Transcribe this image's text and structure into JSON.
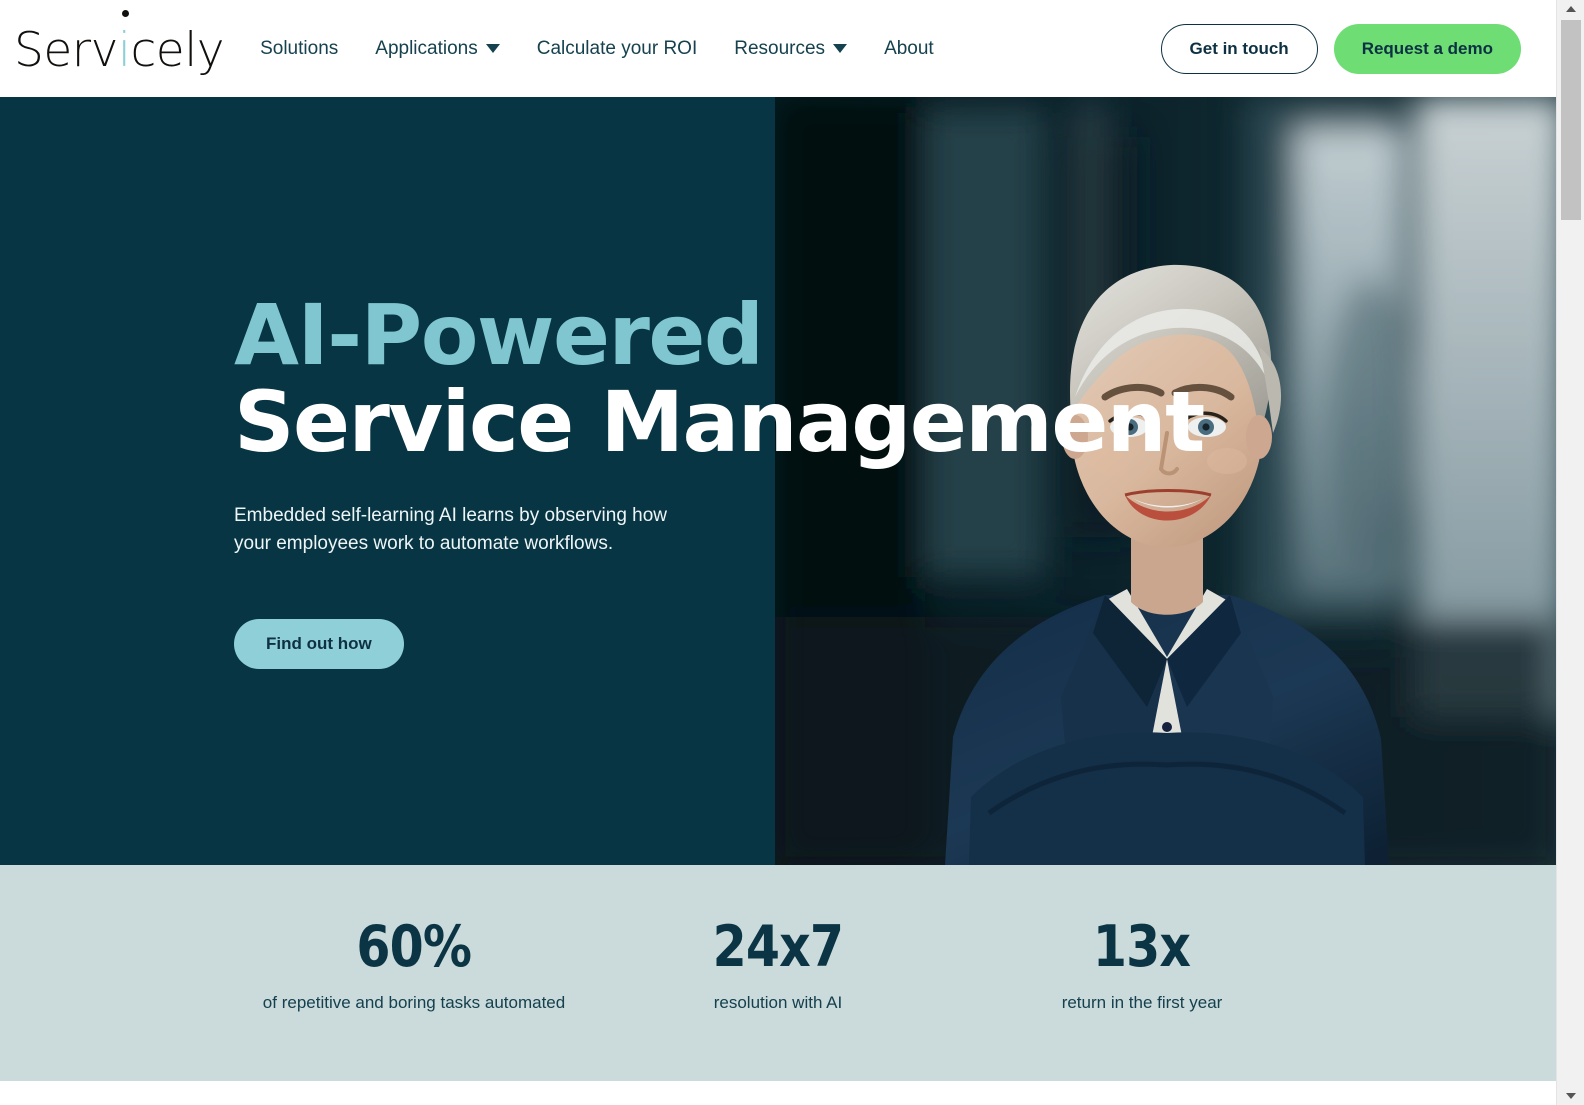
{
  "colors": {
    "hero_bg": "#073543",
    "hero_accent": "#7fc6d0",
    "stats_bg": "#cbdadb",
    "stats_text": "#0b3544",
    "green_cta": "#6ddd74",
    "teal_cta": "#8fd0d8",
    "nav_text": "#16414f"
  },
  "header": {
    "logo": {
      "pre": "Serv",
      "accent": "i",
      "post": "cely",
      "full": "Servicely"
    },
    "nav": [
      {
        "label": "Solutions",
        "has_dropdown": false
      },
      {
        "label": "Applications",
        "has_dropdown": true
      },
      {
        "label": "Calculate your ROI",
        "has_dropdown": false
      },
      {
        "label": "Resources",
        "has_dropdown": true
      },
      {
        "label": "About",
        "has_dropdown": false
      }
    ],
    "get_in_touch": "Get in touch",
    "request_demo": "Request a demo"
  },
  "hero": {
    "headline_line1": "AI-Powered",
    "headline_line2": "Service Management",
    "subtitle": "Embedded self-learning AI learns by observing how your employees work to automate workflows.",
    "cta": "Find out how",
    "image_alt": "Smiling businesswoman with short platinum hair in navy blazer and polka dot blouse, arms crossed, in a modern office"
  },
  "stats": [
    {
      "value": "60%",
      "label": "of repetitive and boring tasks automated"
    },
    {
      "value": "24x7",
      "label": "resolution with AI"
    },
    {
      "value": "13x",
      "label": "return in the first year"
    }
  ],
  "scrollbar": {
    "up_icon": "triangle-up-icon",
    "down_icon": "triangle-down-icon"
  }
}
